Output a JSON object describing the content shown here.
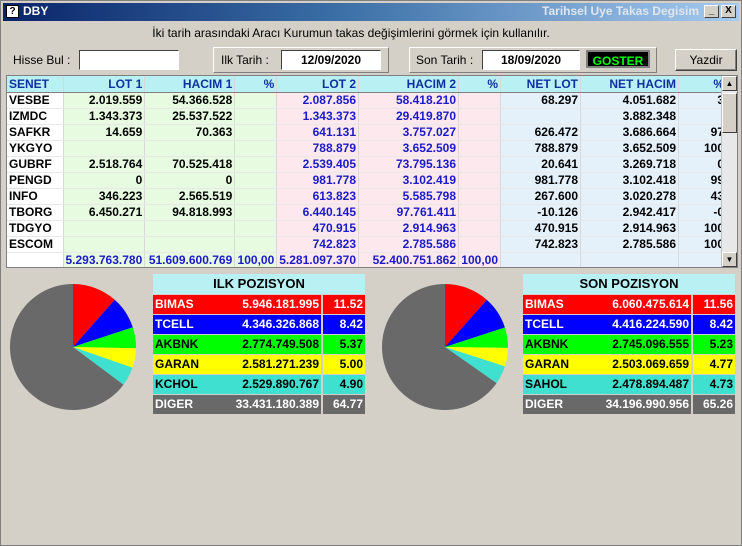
{
  "window": {
    "app_name": "DBY",
    "title": "Tarihsel Uye Takas Degisim",
    "min_glyph": "_",
    "close_glyph": "X"
  },
  "instruction": "İki tarih arasındaki  Aracı Kurumun takas değişimlerini görmek için kullanılır.",
  "filters": {
    "hisse_label": "Hisse Bul :",
    "hisse_value": "",
    "ilk_label": "Ilk Tarih :",
    "ilk_value": "12/09/2020",
    "son_label": "Son Tarih :",
    "son_value": "18/09/2020",
    "goster_label": "GOSTER",
    "yazdir_label": "Yazdir"
  },
  "table": {
    "columns": [
      "SENET",
      "LOT 1",
      "HACIM 1",
      "%",
      "LOT 2",
      "HACIM 2",
      "%",
      "NET LOT",
      "NET HACIM",
      "%"
    ],
    "rows": [
      [
        "VESBE",
        "2.019.559",
        "54.366.528",
        "",
        "2.087.856",
        "58.418.210",
        "",
        "68.297",
        "4.051.682",
        "3"
      ],
      [
        "IZMDC",
        "1.343.373",
        "25.537.522",
        "",
        "1.343.373",
        "29.419.870",
        "",
        "",
        "3.882.348",
        ""
      ],
      [
        "SAFKR",
        "14.659",
        "70.363",
        "",
        "641.131",
        "3.757.027",
        "",
        "626.472",
        "3.686.664",
        "97"
      ],
      [
        "YKGYO",
        "",
        "",
        "",
        "788.879",
        "3.652.509",
        "",
        "788.879",
        "3.652.509",
        "100"
      ],
      [
        "GUBRF",
        "2.518.764",
        "70.525.418",
        "",
        "2.539.405",
        "73.795.136",
        "",
        "20.641",
        "3.269.718",
        "0"
      ],
      [
        "PENGD",
        "0",
        "0",
        "",
        "981.778",
        "3.102.419",
        "",
        "981.778",
        "3.102.418",
        "99"
      ],
      [
        "INFO",
        "346.223",
        "2.565.519",
        "",
        "613.823",
        "5.585.798",
        "",
        "267.600",
        "3.020.278",
        "43"
      ],
      [
        "TBORG",
        "6.450.271",
        "94.818.993",
        "",
        "6.440.145",
        "97.761.411",
        "",
        "-10.126",
        "2.942.417",
        "-0"
      ],
      [
        "TDGYO",
        "",
        "",
        "",
        "470.915",
        "2.914.963",
        "",
        "470.915",
        "2.914.963",
        "100"
      ],
      [
        "ESCOM",
        "",
        "",
        "",
        "742.823",
        "2.785.586",
        "",
        "742.823",
        "2.785.586",
        "100"
      ]
    ],
    "totals": [
      "",
      "5.293.763.780",
      "51.609.600.769",
      "100,00",
      "5.281.097.370",
      "52.400.751.862",
      "100,00",
      "",
      "",
      ""
    ]
  },
  "ilk_pozisyon": {
    "title": "ILK POZISYON",
    "items": [
      {
        "name": "BIMAS",
        "value": "5.946.181.995",
        "pct": "11.52",
        "pct_num": 11.52,
        "color": "#ff0000",
        "text": "#ffffff"
      },
      {
        "name": "TCELL",
        "value": "4.346.326.868",
        "pct": "8.42",
        "pct_num": 8.42,
        "color": "#0000ff",
        "text": "#ffffff"
      },
      {
        "name": "AKBNK",
        "value": "2.774.749.508",
        "pct": "5.37",
        "pct_num": 5.37,
        "color": "#00ff00",
        "text": "#000000"
      },
      {
        "name": "GARAN",
        "value": "2.581.271.239",
        "pct": "5.00",
        "pct_num": 5.0,
        "color": "#ffff00",
        "text": "#000000"
      },
      {
        "name": "KCHOL",
        "value": "2.529.890.767",
        "pct": "4.90",
        "pct_num": 4.9,
        "color": "#40e0d0",
        "text": "#000000"
      },
      {
        "name": "DIGER",
        "value": "33.431.180.389",
        "pct": "64.77",
        "pct_num": 64.77,
        "color": "#696969",
        "text": "#ffffff"
      }
    ]
  },
  "son_pozisyon": {
    "title": "SON POZISYON",
    "items": [
      {
        "name": "BIMAS",
        "value": "6.060.475.614",
        "pct": "11.56",
        "pct_num": 11.56,
        "color": "#ff0000",
        "text": "#ffffff"
      },
      {
        "name": "TCELL",
        "value": "4.416.224.590",
        "pct": "8.42",
        "pct_num": 8.42,
        "color": "#0000ff",
        "text": "#ffffff"
      },
      {
        "name": "AKBNK",
        "value": "2.745.096.555",
        "pct": "5.23",
        "pct_num": 5.23,
        "color": "#00ff00",
        "text": "#000000"
      },
      {
        "name": "GARAN",
        "value": "2.503.069.659",
        "pct": "4.77",
        "pct_num": 4.77,
        "color": "#ffff00",
        "text": "#000000"
      },
      {
        "name": "SAHOL",
        "value": "2.478.894.487",
        "pct": "4.73",
        "pct_num": 4.73,
        "color": "#40e0d0",
        "text": "#000000"
      },
      {
        "name": "DIGER",
        "value": "34.196.990.956",
        "pct": "65.26",
        "pct_num": 65.26,
        "color": "#696969",
        "text": "#ffffff"
      }
    ]
  }
}
